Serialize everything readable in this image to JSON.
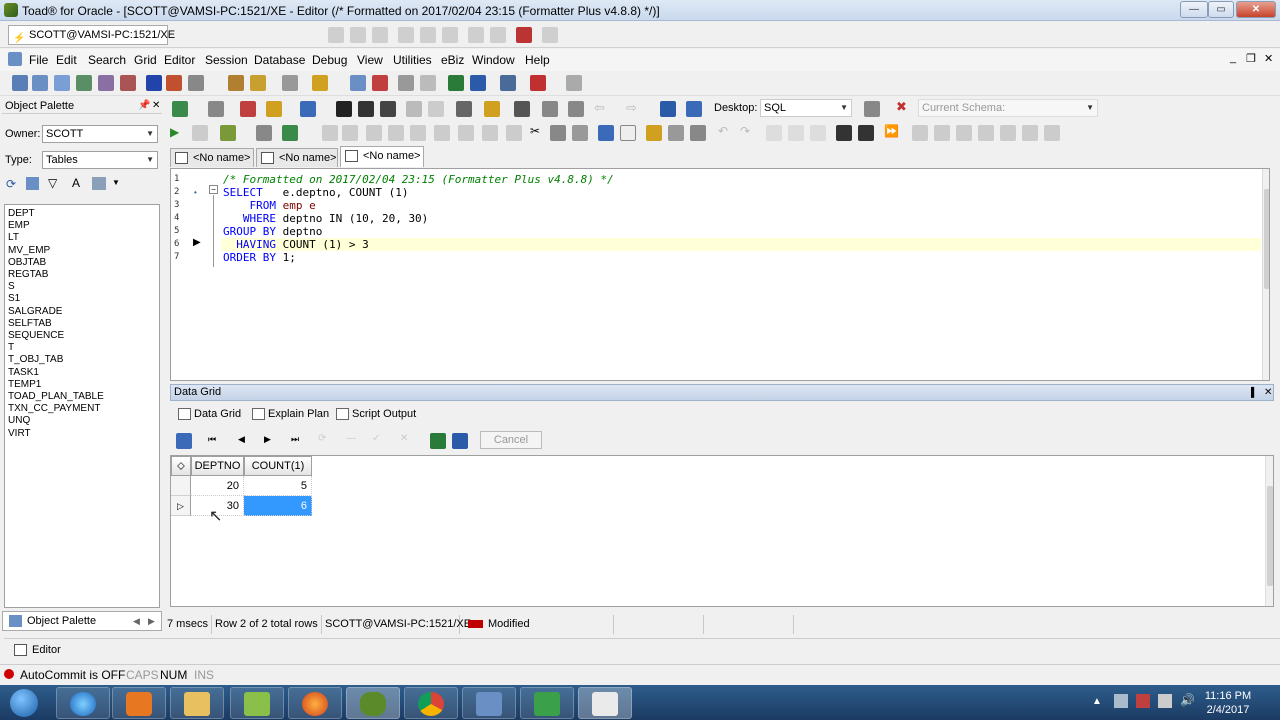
{
  "window": {
    "title": "Toad® for Oracle - [SCOTT@VAMSI-PC:1521/XE - Editor (/* Formatted on 2017/02/04 23:15 (Formatter Plus v4.8.8) */)]"
  },
  "connection_tab": "SCOTT@VAMSI-PC:1521/XE",
  "menu": [
    "File",
    "Edit",
    "Search",
    "Grid",
    "Editor",
    "Session",
    "Database",
    "Debug",
    "View",
    "Utilities",
    "eBiz",
    "Window",
    "Help"
  ],
  "toolbar": {
    "desktop_label": "Desktop:",
    "desktop_value": "SQL",
    "schema_placeholder": "Current Schema:"
  },
  "object_palette": {
    "title": "Object Palette",
    "owner_label": "Owner:",
    "owner_value": "SCOTT",
    "type_label": "Type:",
    "type_value": "Tables",
    "objects": [
      "DEPT",
      "EMP",
      "LT",
      "MV_EMP",
      "OBJTAB",
      "REGTAB",
      "S",
      "S1",
      "SALGRADE",
      "SELFTAB",
      "SEQUENCE",
      "T",
      "T_OBJ_TAB",
      "TASK1",
      "TEMP1",
      "TOAD_PLAN_TABLE",
      "TXN_CC_PAYMENT",
      "UNQ",
      "VIRT"
    ],
    "bottom_tab": "Object Palette"
  },
  "editor_tabs": [
    "<No name>",
    "<No name>",
    "<No name>"
  ],
  "editor": {
    "line_numbers": [
      "1",
      "2",
      "3",
      "4",
      "5",
      "6",
      "7"
    ],
    "lines": [
      [
        {
          "t": "/* Formatted on 2017/02/04 23:15 (Formatter Plus v4.8.8) */",
          "c": "cm"
        }
      ],
      [
        {
          "t": "SELECT",
          "c": "kw"
        },
        {
          "t": "   e.deptno, COUNT (1)",
          "c": ""
        }
      ],
      [
        {
          "t": "    FROM ",
          "c": "kw"
        },
        {
          "t": "emp e",
          "c": "tbl"
        }
      ],
      [
        {
          "t": "   WHERE ",
          "c": "kw"
        },
        {
          "t": "deptno IN (10, 20, 30)",
          "c": ""
        }
      ],
      [
        {
          "t": "GROUP BY ",
          "c": "kw"
        },
        {
          "t": "deptno",
          "c": ""
        }
      ],
      [
        {
          "t": "  HAVING ",
          "c": "kw"
        },
        {
          "t": "COUNT (1) > 3",
          "c": ""
        }
      ],
      [
        {
          "t": "ORDER BY ",
          "c": "kw"
        },
        {
          "t": "1;",
          "c": ""
        }
      ]
    ]
  },
  "data_grid": {
    "title": "Data Grid",
    "tabs": [
      "Data Grid",
      "Explain Plan",
      "Script Output"
    ],
    "cancel_label": "Cancel",
    "columns": [
      "DEPTNO",
      "COUNT(1)"
    ],
    "rows": [
      [
        "20",
        "5"
      ],
      [
        "30",
        "6"
      ]
    ]
  },
  "status": {
    "time": "7 msecs",
    "rows": "Row 2 of 2 total rows",
    "conn": "SCOTT@VAMSI-PC:1521/XE",
    "state": "Modified"
  },
  "editor_bottom_tab": "Editor",
  "indicators": {
    "autocommit": "AutoCommit is OFF",
    "caps": "CAPS",
    "num": "NUM",
    "ins": "INS"
  },
  "clock": {
    "time": "11:16 PM",
    "date": "2/4/2017"
  },
  "colors": {
    "selection": "#3399ff",
    "keyword": "#0000ff",
    "comment": "#008000",
    "taskbar": "#1b3b63"
  }
}
